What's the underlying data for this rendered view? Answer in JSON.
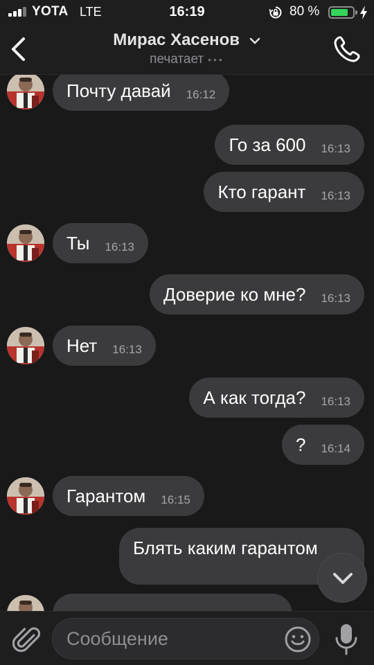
{
  "status_bar": {
    "carrier": "YOTA",
    "network": "LTE",
    "time": "16:19",
    "battery_percent": "80 %",
    "battery_level": 0.8
  },
  "header": {
    "contact_name": "Мирас Хасенов",
    "status": "печатает",
    "status_dots": "•••"
  },
  "messages": [
    {
      "side": "in",
      "text": "Почту давай",
      "time": "16:12"
    },
    {
      "side": "out",
      "text": "Го за 600",
      "time": "16:13"
    },
    {
      "side": "out",
      "text": "Кто гарант",
      "time": "16:13"
    },
    {
      "side": "in",
      "text": "Ты",
      "time": "16:13"
    },
    {
      "side": "out",
      "text": "Доверие ко мне?",
      "time": "16:13"
    },
    {
      "side": "in",
      "text": "Нет",
      "time": "16:13"
    },
    {
      "side": "out",
      "text": "А как тогда?",
      "time": "16:13"
    },
    {
      "side": "out",
      "text": "?",
      "time": "16:14"
    },
    {
      "side": "in",
      "text": "Гарантом",
      "time": "16:15"
    },
    {
      "side": "out",
      "text": "Блять каким гарантом",
      "time": ""
    },
    {
      "side": "in",
      "text": "",
      "time": ""
    }
  ],
  "composer": {
    "placeholder": "Сообщение"
  },
  "colors": {
    "background": "#19191a",
    "bubble": "#3b3b3d",
    "battery": "#35d45a"
  },
  "icons": [
    "back-chevron-icon",
    "chevron-down-icon",
    "phone-icon",
    "paperclip-icon",
    "smiley-icon",
    "microphone-icon",
    "scroll-down-chevron-icon",
    "lock-rotation-icon",
    "bolt-icon"
  ]
}
